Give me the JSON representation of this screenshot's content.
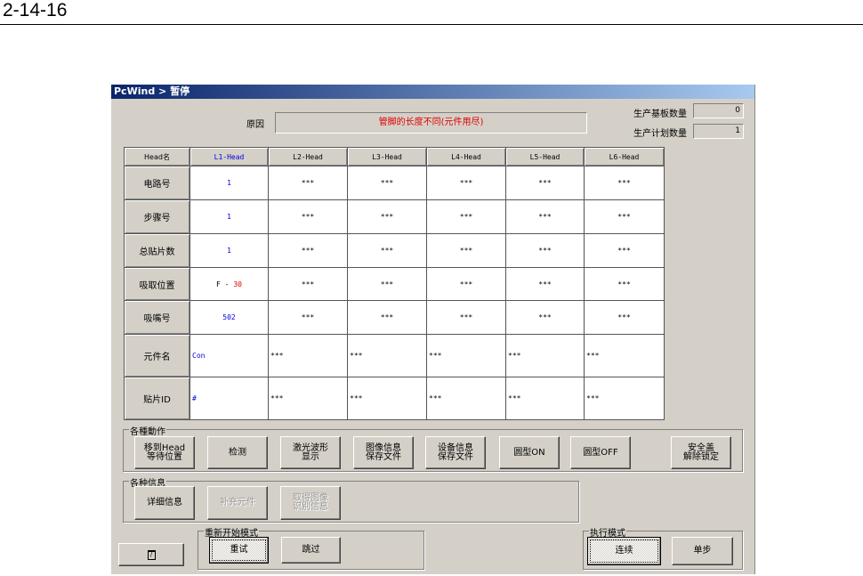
{
  "page_number": "2-14-16",
  "window": {
    "title": "PcWind > 暂停"
  },
  "reason": {
    "label": "原因",
    "value": "管脚的长度不同(元件用尽)"
  },
  "counters": [
    {
      "label": "生产基板数量",
      "value": "0"
    },
    {
      "label": "生产计划数量",
      "value": "1"
    }
  ],
  "table": {
    "headers": [
      "Head名",
      "L1-Head",
      "L2-Head",
      "L3-Head",
      "L4-Head",
      "L5-Head",
      "L6-Head"
    ],
    "rows": [
      {
        "label": "电路号",
        "cells": [
          "1",
          "***",
          "***",
          "***",
          "***",
          "***"
        ]
      },
      {
        "label": "步骤号",
        "cells": [
          "1",
          "***",
          "***",
          "***",
          "***",
          "***"
        ]
      },
      {
        "label": "总贴片数",
        "cells": [
          "1",
          "***",
          "***",
          "***",
          "***",
          "***"
        ]
      },
      {
        "label": "吸取位置",
        "cells": [
          "F - ",
          "***",
          "***",
          "***",
          "***",
          "***"
        ],
        "l1_suffix": "30"
      },
      {
        "label": "吸嘴号",
        "cells": [
          "502",
          "***",
          "***",
          "***",
          "***",
          "***"
        ]
      },
      {
        "label": "元件名",
        "cells": [
          "Con",
          "***",
          "***",
          "***",
          "***",
          "***"
        ]
      },
      {
        "label": "贴片ID",
        "cells": [
          "#",
          "***",
          "***",
          "***",
          "***",
          "***"
        ]
      }
    ]
  },
  "actions": {
    "title": "各種動作",
    "buttons": [
      "移到Head\n等待位置",
      "检测",
      "激光波形\n显示",
      "图像信息\n保存文件",
      "设备信息\n保存文件",
      "圆型ON",
      "圆型OFF",
      "安全盖\n解除锁定"
    ]
  },
  "info": {
    "title": "各种信息",
    "buttons": [
      "详细信息",
      "补充元件",
      "取得图像\n识别信息"
    ]
  },
  "restart": {
    "title": "重新开始模式",
    "buttons": [
      "重试",
      "跳过"
    ]
  },
  "exec": {
    "title": "执行模式",
    "buttons": [
      "连续",
      "单步"
    ]
  },
  "colors": {
    "title_start": "#0a246a",
    "reason_text": "#e00000",
    "l1_text": "#0000e0"
  }
}
